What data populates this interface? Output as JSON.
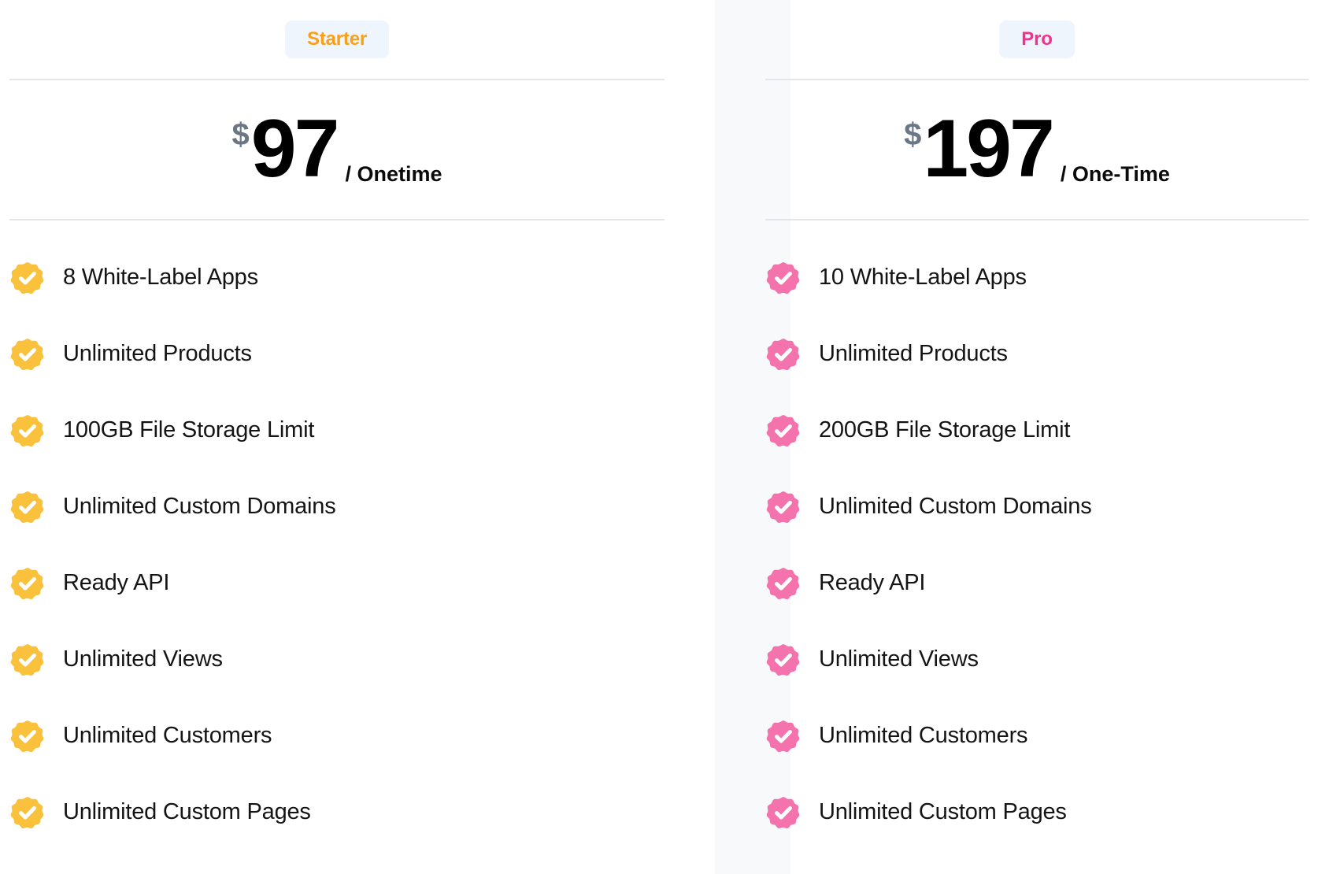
{
  "theme": {
    "starter_accent": "#f9a01b",
    "pro_accent": "#f0338a",
    "badge_bg": "#eff5fd",
    "divider": "#e2e6ea",
    "gap_strip_bg": "#f7f9fb",
    "currency_color": "#6b7785",
    "text_color": "#141414"
  },
  "plans": [
    {
      "id": "starter",
      "badge_label": "Starter",
      "currency_symbol": "$",
      "price": "97",
      "period": "/ Onetime",
      "features": [
        "8 White-Label Apps",
        "Unlimited Products",
        "100GB File Storage Limit",
        "Unlimited Custom Domains",
        "Ready API",
        "Unlimited Views",
        "Unlimited Customers",
        "Unlimited Custom Pages"
      ]
    },
    {
      "id": "pro",
      "badge_label": "Pro",
      "currency_symbol": "$",
      "price": "197",
      "period": "/ One-Time",
      "features": [
        "10 White-Label Apps",
        "Unlimited Products",
        "200GB File Storage Limit",
        "Unlimited Custom Domains",
        "Ready API",
        "Unlimited Views",
        "Unlimited Customers",
        "Unlimited Custom Pages"
      ]
    }
  ],
  "icons": {
    "feature_check": "check-badge-icon"
  }
}
